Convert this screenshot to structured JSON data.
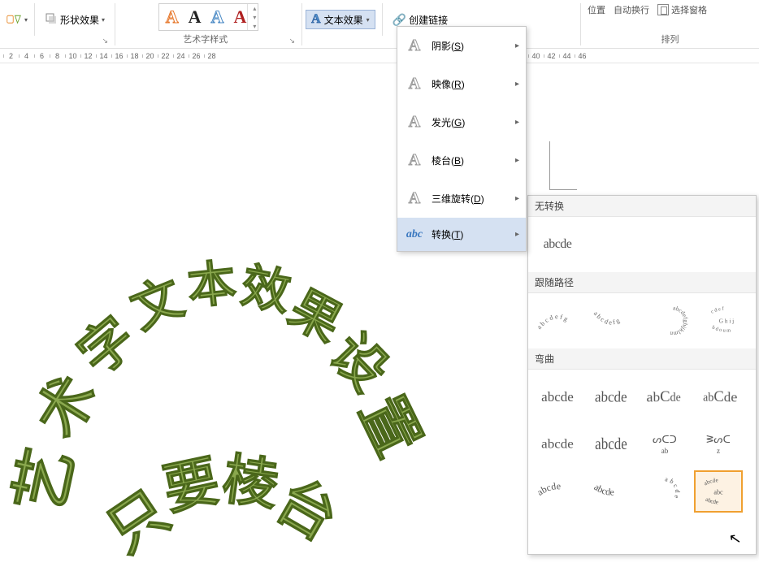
{
  "ribbon": {
    "shape_effects": "形状效果",
    "wordart_styles_label": "艺术字样式",
    "text_effects": "文本效果",
    "create_link": "创建链接",
    "arrange_label": "排列",
    "position": "位置",
    "wrap": "自动换行",
    "selection_pane": "选择窗格",
    "partial_word1": "本"
  },
  "ruler": {
    "ticks_left": [
      "2",
      "4",
      "6",
      "8",
      "10",
      "12",
      "14",
      "16",
      "18",
      "20",
      "22",
      "24",
      "26",
      "28"
    ],
    "ticks_right": [
      "40",
      "42",
      "44",
      "46"
    ]
  },
  "dropdown": {
    "items": [
      {
        "label": "阴影",
        "key": "S"
      },
      {
        "label": "映像",
        "key": "R"
      },
      {
        "label": "发光",
        "key": "G"
      },
      {
        "label": "棱台",
        "key": "B"
      },
      {
        "label": "三维旋转",
        "key": "D"
      },
      {
        "label": "转换",
        "key": "T"
      }
    ]
  },
  "transform_panel": {
    "no_transform": "无转换",
    "no_transform_sample": "abcde",
    "follow_path": "跟随路径",
    "warp": "弯曲"
  },
  "wordart": {
    "line1": "艺术字文本效果设置",
    "line2": "只要棱台"
  },
  "chart_data": null
}
